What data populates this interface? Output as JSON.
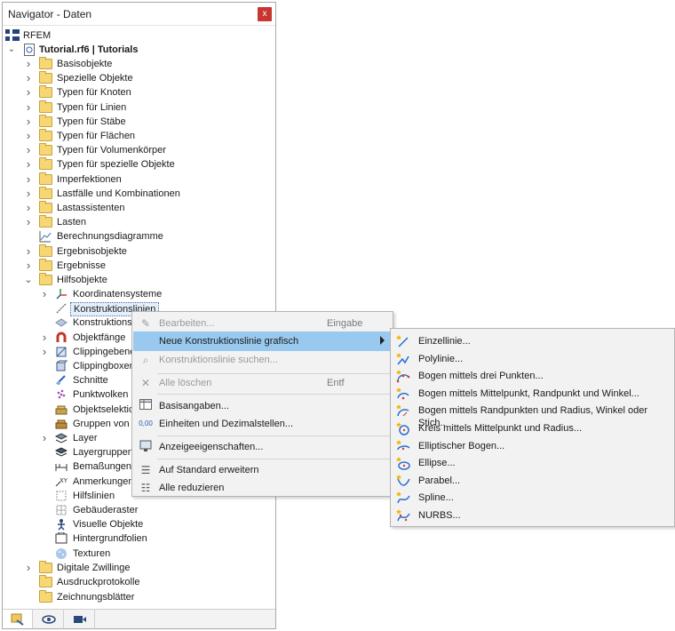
{
  "window": {
    "title": "Navigator - Daten",
    "close_label": "x"
  },
  "tree": {
    "root": "RFEM",
    "project": "Tutorial.rf6 | Tutorials",
    "project_items": [
      "Basisobjekte",
      "Spezielle Objekte",
      "Typen für Knoten",
      "Typen für Linien",
      "Typen für Stäbe",
      "Typen für Flächen",
      "Typen für Volumenkörper",
      "Typen für spezielle Objekte",
      "Imperfektionen",
      "Lastfälle und Kombinationen",
      "Lastassistenten",
      "Lasten",
      "Berechnungsdiagramme",
      "Ergebnisobjekte",
      "Ergebnisse",
      "Hilfsobjekte"
    ],
    "aux_items": [
      "Koordinatensysteme",
      "Konstruktionslinien",
      "Konstruktionsf",
      "Objektfänge",
      "Clippingebene",
      "Clippingboxen",
      "Schnitte",
      "Punktwolken",
      "Objektselektio",
      "Gruppen von O",
      "Layer",
      "Layergruppen",
      "Bemaßungen",
      "Anmerkungen",
      "Hilfslinien",
      "Gebäuderaster",
      "Visuelle Objekte",
      "Hintergrundfolien",
      "Texturen"
    ],
    "tail_items": [
      "Digitale Zwillinge",
      "Ausdruckprotokolle",
      "Zeichnungsblätter"
    ]
  },
  "bottom_tabs": [
    "data-tab-icon",
    "view-tab-icon",
    "video-tab-icon"
  ],
  "context_menu": {
    "items": [
      {
        "label": "Bearbeiten...",
        "shortcut": "Eingabe"
      },
      {
        "label": "Neue Konstruktionslinie grafisch",
        "shortcut": ""
      },
      {
        "label": "Konstruktionslinie suchen...",
        "shortcut": ""
      },
      {
        "label": "Alle löschen",
        "shortcut": "Entf"
      },
      {
        "label": "Basisangaben...",
        "shortcut": ""
      },
      {
        "label": "Einheiten und Dezimalstellen...",
        "shortcut": ""
      },
      {
        "label": "Anzeigeeigenschaften...",
        "shortcut": ""
      },
      {
        "label": "Auf Standard erweitern",
        "shortcut": ""
      },
      {
        "label": "Alle reduzieren",
        "shortcut": ""
      }
    ]
  },
  "submenu": {
    "items": [
      "Einzellinie...",
      "Polylinie...",
      "Bogen mittels drei Punkten...",
      "Bogen mittels Mittelpunkt, Randpunkt und Winkel...",
      "Bogen mittels Randpunkten und Radius, Winkel oder Stich..",
      "Kreis mittels Mittelpunkt und Radius...",
      "Elliptischer Bogen...",
      "Ellipse...",
      "Parabel...",
      "Spline...",
      "NURBS..."
    ]
  },
  "colors": {
    "highlight": "#99c9ef",
    "folder": "#f7d774",
    "close": "#c8362f"
  }
}
